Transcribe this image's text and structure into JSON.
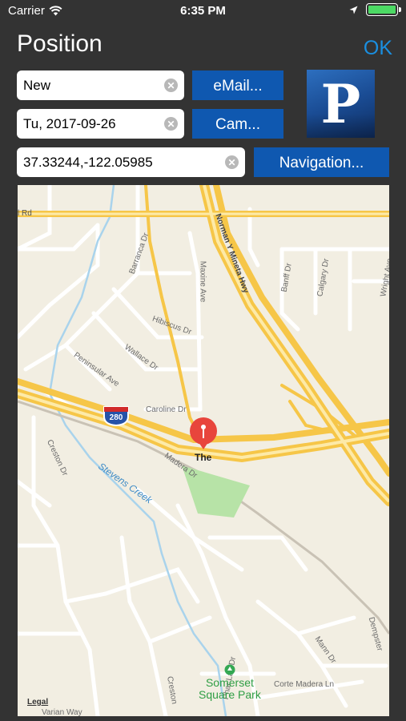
{
  "status_bar": {
    "carrier": "Carrier",
    "time": "6:35 PM",
    "battery_percent": 100
  },
  "header": {
    "title": "Position",
    "ok_label": "OK"
  },
  "form": {
    "name_value": "New",
    "date_value": "Tu, 2017-09-26",
    "coords_value": "37.33244,-122.05985",
    "email_label": "eMail...",
    "camera_label": "Cam...",
    "navigation_label": "Navigation..."
  },
  "logo": {
    "letter": "P"
  },
  "map": {
    "pin_label": "The",
    "park_line1": "Somerset",
    "park_line2": "Square Park",
    "legal": "Legal",
    "highway_shield": "280",
    "creek": "Stevens Creek",
    "streets": {
      "top_rd": "l Rd",
      "norman": "Norman Y Mineta Hwy",
      "barranca": "Barranca Dr",
      "maxine": "Maxine Ave",
      "hibiscus": "Hibiscus Dr",
      "wallace": "Wallace Dr",
      "peninsular": "Peninsular Ave",
      "caroline": "Caroline Dr",
      "banff": "Banff Dr",
      "calgary": "Calgary Dr",
      "wright": "Wright Ave",
      "creston": "Creston Dr",
      "madera": "Madera Dr",
      "mann": "Mann Dr",
      "dempster": "Dempster",
      "phar_lap": "Phar Lap Dr",
      "corte_madera": "Corte Madera Ln",
      "creston2": "Creston",
      "varian": "Varian Way"
    }
  },
  "colors": {
    "background": "#333333",
    "button": "#0f58b0",
    "ok": "#1a8fe0",
    "pin": "#e8453c",
    "park": "#b7e3a7"
  }
}
